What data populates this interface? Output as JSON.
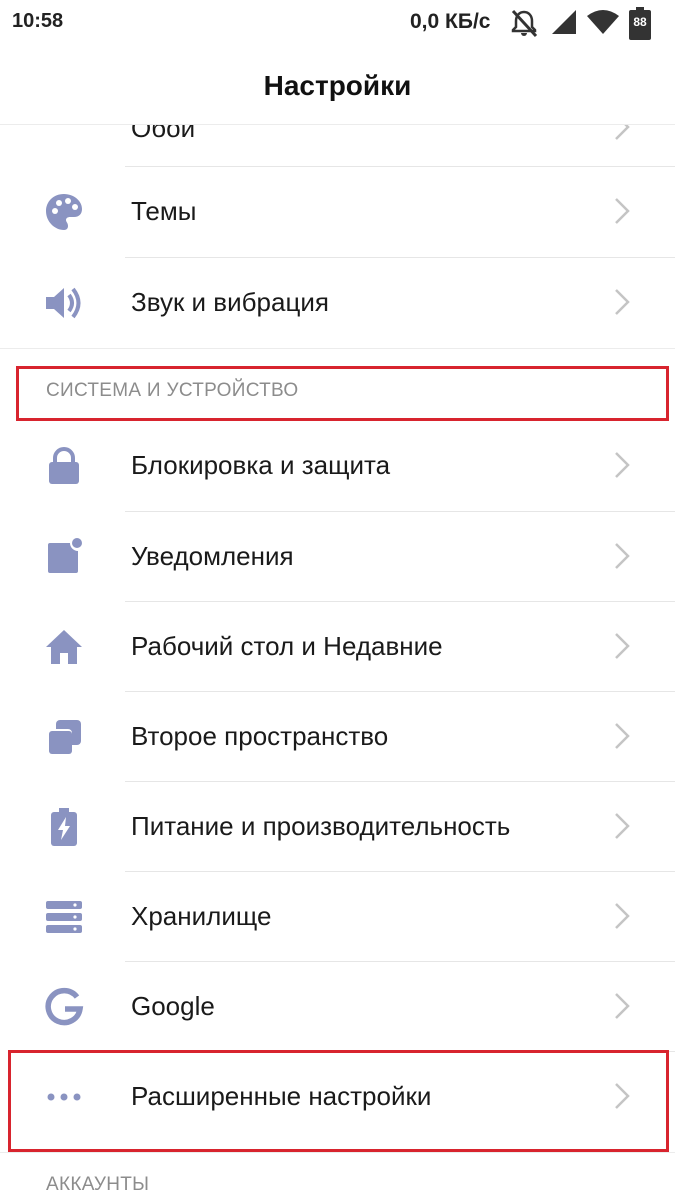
{
  "status_bar": {
    "time": "10:58",
    "speed": "0,0 КБ/с",
    "battery": "88",
    "icons": [
      "mute-icon",
      "signal-icon",
      "wifi-icon",
      "battery-icon"
    ]
  },
  "header": {
    "title": "Настройки"
  },
  "theme": {
    "icon_color": "#8a93c1",
    "accent_outline": "#d8242e",
    "chevron_color": "#c4c4c4"
  },
  "items_top": [
    {
      "label": "Обои",
      "icon": "wallpaper-icon"
    },
    {
      "label": "Темы",
      "icon": "palette-icon"
    },
    {
      "label": "Звук и вибрация",
      "icon": "speaker-icon"
    }
  ],
  "section_system": {
    "label": "СИСТЕМА И УСТРОЙСТВО"
  },
  "items_system": [
    {
      "label": "Блокировка и защита",
      "icon": "lock-icon"
    },
    {
      "label": "Уведомления",
      "icon": "notification-icon"
    },
    {
      "label": "Рабочий стол и Недавние",
      "icon": "home-icon"
    },
    {
      "label": "Второе пространство",
      "icon": "second-space-icon"
    },
    {
      "label": "Питание и производительность",
      "icon": "battery-power-icon"
    },
    {
      "label": "Хранилище",
      "icon": "storage-icon"
    },
    {
      "label": "Google",
      "icon": "google-icon"
    },
    {
      "label": "Расширенные настройки",
      "icon": "more-dots-icon"
    }
  ],
  "section_accounts": {
    "label": "АККАУНТЫ"
  }
}
